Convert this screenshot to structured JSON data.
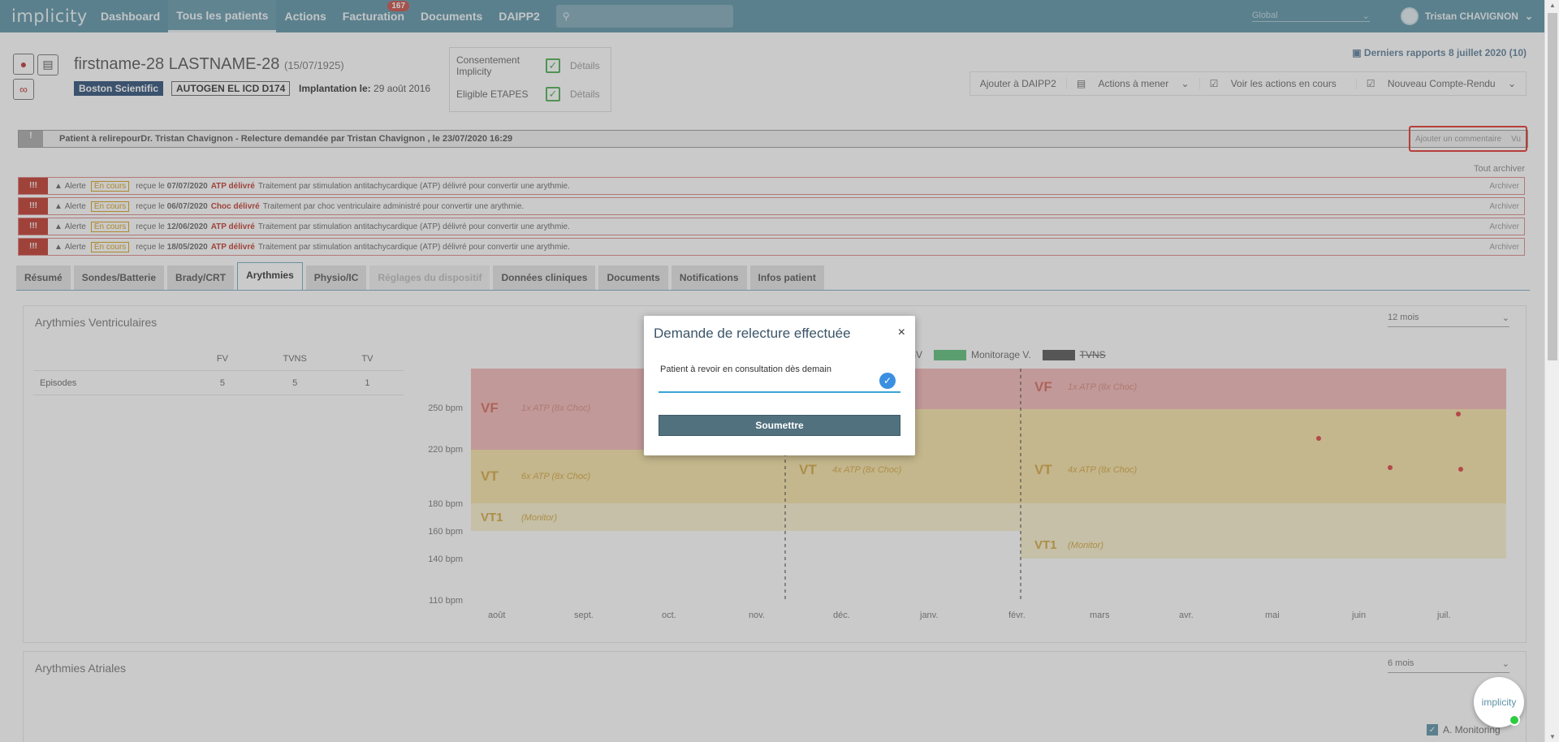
{
  "nav": {
    "logo": "implicity",
    "items": [
      "Dashboard",
      "Tous les patients",
      "Actions",
      "Facturation",
      "Documents",
      "DAIPP2"
    ],
    "badge": "167",
    "search_icon": "search-icon",
    "lang": "Global",
    "user": "Tristan CHAVIGNON"
  },
  "patient": {
    "name": "firstname-28 LASTNAME-28",
    "dob": "(15/07/1925)",
    "brand": "Boston Scientific",
    "model": "AUTOGEN EL ICD D174",
    "implant_label": "Implantation le:",
    "implant_date": "29 août 2016"
  },
  "consent": {
    "row1_label": "Consentement Implicity",
    "row2_label": "Eligible ETAPES",
    "details": "Détails"
  },
  "reports": "Derniers rapports 8 juillet 2020 (10)",
  "actions_bar": [
    "Ajouter à DAIPP2",
    "Actions à mener",
    "Voir les actions en cours",
    "Nouveau Compte-Rendu"
  ],
  "reread": {
    "bang": "!",
    "text": "Patient à relirepourDr. Tristan Chavignon - Relecture demandée par Tristan Chavignon , le 23/07/2020 16:29",
    "add_comment": "Ajouter un commentaire",
    "vu": "Vu"
  },
  "archive_all": "Tout archiver",
  "alerts": [
    {
      "date": "07/07/2020",
      "kind": "ATP délivré",
      "desc": "Traitement par stimulation antitachycardique (ATP) délivré pour convertir une arythmie."
    },
    {
      "date": "06/07/2020",
      "kind": "Choc délivré",
      "desc": "Traitement par choc ventriculaire administré pour convertir une arythmie."
    },
    {
      "date": "12/06/2020",
      "kind": "ATP délivré",
      "desc": "Traitement par stimulation antitachycardique (ATP) délivré pour convertir une arythmie."
    },
    {
      "date": "18/05/2020",
      "kind": "ATP délivré",
      "desc": "Traitement par stimulation antitachycardique (ATP) délivré pour convertir une arythmie."
    }
  ],
  "alert_labels": {
    "bang": "!!!",
    "alert": "Alerte",
    "status": "En cours",
    "received": "reçue le",
    "archive": "Archiver"
  },
  "tabs": [
    "Résumé",
    "Sondes/Batterie",
    "Brady/CRT",
    "Arythmies",
    "Physio/IC",
    "Réglages du dispositif",
    "Données cliniques",
    "Documents",
    "Notifications",
    "Infos patient"
  ],
  "ventricular": {
    "title": "Arythmies Ventriculaires",
    "period": "12 mois",
    "headers": [
      "",
      "FV",
      "TVNS",
      "TV"
    ],
    "rows": [
      [
        "Episodes",
        "5",
        "5",
        "1"
      ]
    ]
  },
  "legend": [
    {
      "label": "ESV",
      "color": "#ffffff"
    },
    {
      "label": "Monitorage V.",
      "color": "#5bbf7a"
    },
    {
      "label": "TVNS",
      "color": "#555555"
    }
  ],
  "chart_data": {
    "type": "scatter",
    "ylabel_ticks": [
      "250 bpm",
      "220 bpm",
      "180 bpm",
      "160 bpm",
      "140 bpm",
      "110 bpm"
    ],
    "x_ticks": [
      "août",
      "sept.",
      "oct.",
      "nov.",
      "déc.",
      "janv.",
      "févr.",
      "mars",
      "avr.",
      "mai",
      "juin",
      "juil."
    ],
    "zones": [
      {
        "name": "VF",
        "note": "1x ATP (8x Choc)"
      },
      {
        "name": "VT",
        "note": "6x ATP (8x Choc)"
      },
      {
        "name": "VT1",
        "note": "(Monitor)"
      },
      {
        "name": "VT",
        "note": "4x ATP (8x Choc)"
      },
      {
        "name": "VF",
        "note": "1x ATP (8x Choc)"
      },
      {
        "name": "VT",
        "note": "4x ATP (8x Choc)"
      },
      {
        "name": "VT1",
        "note": "(Monitor)"
      }
    ],
    "colors": {
      "vf": "#f3b7b7",
      "vt": "#f6e3a6",
      "vt1": "#f8f1cc",
      "point": "#e04040"
    }
  },
  "atrial": {
    "title": "Arythmies Atriales",
    "period": "6 mois",
    "monitoring": "A. Monitoring"
  },
  "modal": {
    "title": "Demande de relecture effectuée",
    "close": "×",
    "input_value": "Patient à revoir en consultation dès demain",
    "submit": "Soumettre"
  },
  "chat": "implicity"
}
